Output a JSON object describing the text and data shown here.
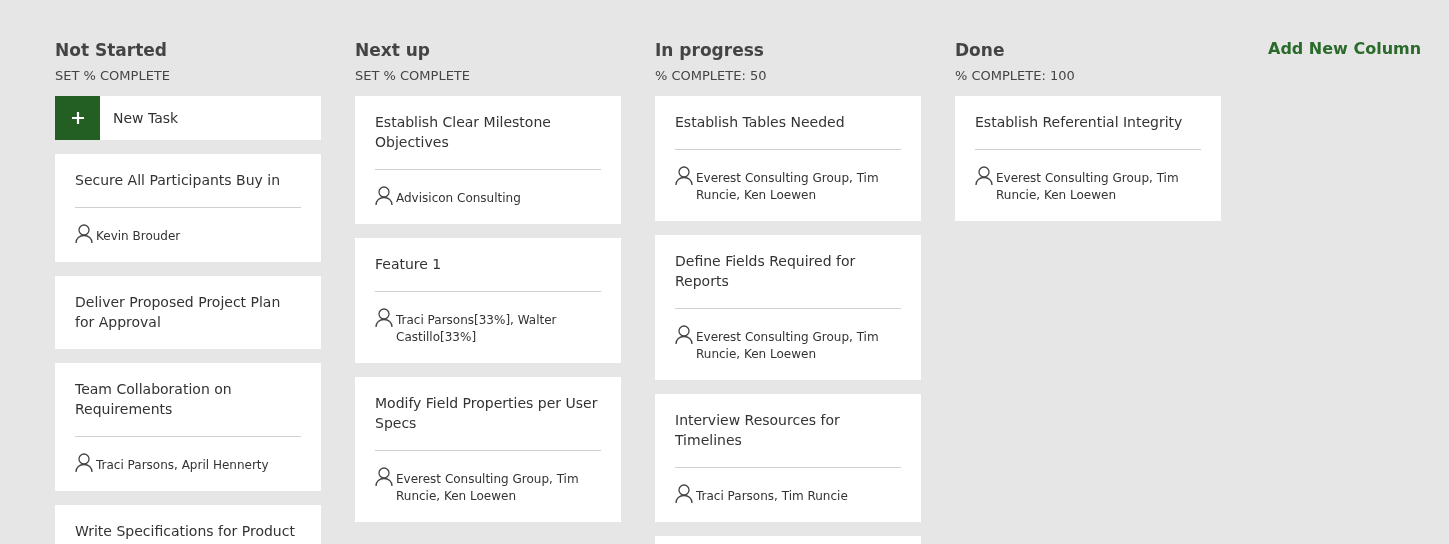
{
  "columns": [
    {
      "title": "Not Started",
      "subtitle": "SET % COMPLETE",
      "new_task": "New Task",
      "cards": [
        {
          "kind": "task",
          "title": "Secure All Participants Buy in",
          "assignees": "Kevin Brouder"
        },
        {
          "kind": "task",
          "title": "Deliver Proposed Project Plan for Approval"
        },
        {
          "kind": "task",
          "title": "Team Collaboration on Requirements",
          "assignees": "Traci Parsons, April Hennerty"
        },
        {
          "kind": "task",
          "title": "Write Specifications for Product"
        }
      ]
    },
    {
      "title": "Next up",
      "subtitle": "SET % COMPLETE",
      "cards": [
        {
          "kind": "task",
          "title": "Establish Clear Milestone Objectives",
          "assignees": "Advisicon Consulting"
        },
        {
          "kind": "task",
          "title": "Feature 1",
          "assignees": "Traci Parsons[33%], Walter Castillo[33%]"
        },
        {
          "kind": "task",
          "title": "Modify Field Properties per User Specs",
          "assignees": "Everest Consulting Group, Tim Runcie, Ken Loewen"
        }
      ]
    },
    {
      "title": "In progress",
      "subtitle": "% COMPLETE: 50",
      "cards": [
        {
          "kind": "task",
          "title": "Establish Tables Needed",
          "assignees": "Everest Consulting Group, Tim Runcie, Ken Loewen"
        },
        {
          "kind": "task",
          "title": "Define Fields Required for Reports",
          "assignees": "Everest Consulting Group, Tim Runcie, Ken Loewen"
        },
        {
          "kind": "task",
          "title": "Interview Resources for Timelines",
          "assignees": "Traci Parsons, Tim Runcie"
        },
        {
          "kind": "blank"
        }
      ]
    },
    {
      "title": "Done",
      "subtitle": "% COMPLETE: 100",
      "cards": [
        {
          "kind": "task",
          "title": "Establish Referential Integrity",
          "assignees": "Everest Consulting Group, Tim Runcie, Ken Loewen"
        }
      ]
    }
  ],
  "add_column": "Add New Column"
}
